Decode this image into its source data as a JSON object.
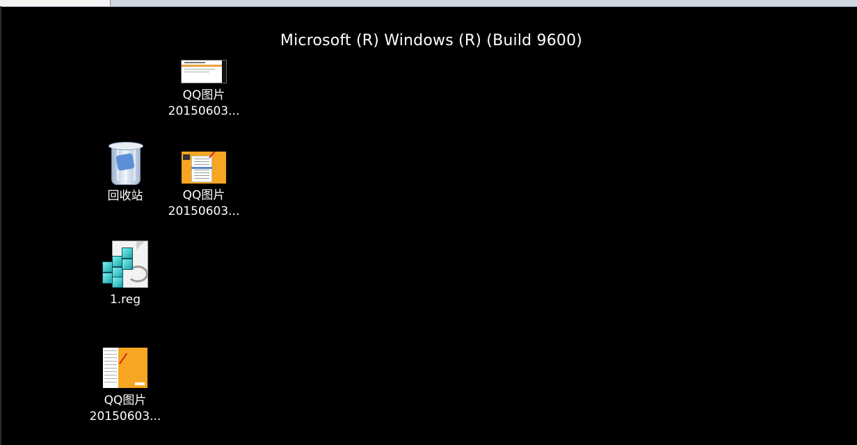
{
  "system": {
    "watermark": "Microsoft (R) Windows (R) (Build 9600)"
  },
  "desktop": {
    "icons": [
      {
        "name": "qq-image-top",
        "label_line1": "QQ图片",
        "label_line2": "20150603..."
      },
      {
        "name": "recycle-bin",
        "label_line1": "回收站"
      },
      {
        "name": "qq-image-middle",
        "label_line1": "QQ图片",
        "label_line2": "20150603..."
      },
      {
        "name": "reg-file",
        "label_line1": "1.reg"
      },
      {
        "name": "qq-image-bottom",
        "label_line1": "QQ图片",
        "label_line2": "20150603..."
      }
    ]
  },
  "colors": {
    "background": "#000000",
    "top_strip": "#cfd6e4",
    "orange_thumb": "#f6a623"
  },
  "icon_semantics": [
    "image-thumbnail-icon",
    "recycle-bin-icon",
    "registry-file-icon"
  ]
}
